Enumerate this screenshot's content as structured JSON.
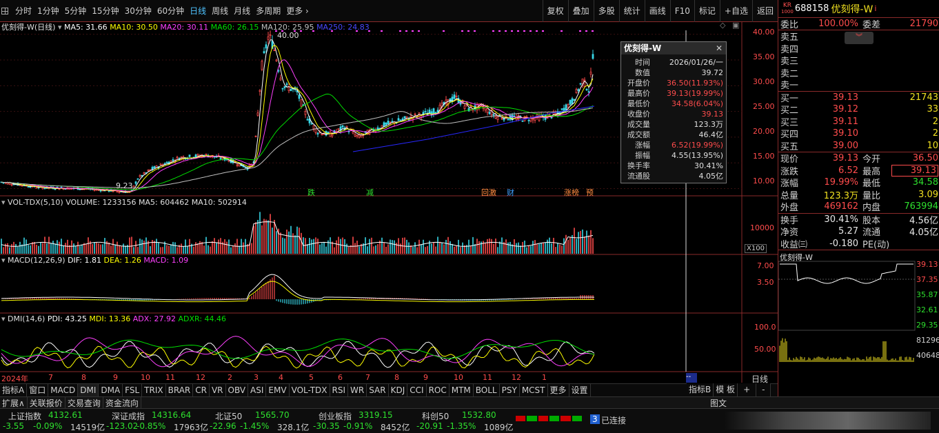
{
  "toolbar": {
    "periods": [
      "分时",
      "1分钟",
      "5分钟",
      "15分钟",
      "30分钟",
      "60分钟",
      "日线",
      "周线",
      "月线",
      "多周期",
      "更多"
    ],
    "active": "日线",
    "right": [
      "复权",
      "叠加",
      "多股",
      "统计",
      "画线",
      "F10",
      "标记",
      "+自选",
      "返回"
    ]
  },
  "main_legend": {
    "title": "优刻得-W(日线)",
    "ma5": "MA5: 31.66",
    "ma10": "MA10: 30.50",
    "ma20": "MA20: 30.11",
    "ma60": "MA60: 26.15",
    "ma120": "MA120: 25.95",
    "ma250": "MA250: 24.83",
    "high_mark": "40.00",
    "low_mark": "9.23"
  },
  "price_axis": [
    "40.00",
    "35.00",
    "30.00",
    "25.00",
    "20.00",
    "15.00",
    "10.00"
  ],
  "event_tags": [
    "跌",
    "减",
    "回激",
    "财",
    "涨榜",
    "预"
  ],
  "vol_legend": {
    "title": "VOL-TDX(5,10)",
    "volume": "VOLUME: 1233156",
    "ma5": "MA5: 604462",
    "ma10": "MA10: 502914",
    "axis": "10000",
    "unit": "X100"
  },
  "macd_legend": {
    "title": "MACD(12,26,9)",
    "dif": "DIF: 1.81",
    "dea": "DEA: 1.26",
    "macd": "MACD: 1.09",
    "axis1": "7.00",
    "axis2": "3.50"
  },
  "dmi_legend": {
    "title": "DMI(14,6)",
    "pdi": "PDI: 43.25",
    "mdi": "MDI: 13.36",
    "adx": "ADX: 27.92",
    "adxr": "ADXR: 44.46",
    "axis1": "100.0",
    "axis2": "50.00"
  },
  "x_axis": [
    "2024年",
    "7",
    "8",
    "9",
    "10",
    "11",
    "12",
    "2",
    "3",
    "4",
    "5",
    "6",
    "7",
    "8",
    "9",
    "10",
    "11",
    "12",
    "1"
  ],
  "tooltip": {
    "title": "优刻得-W",
    "rows": [
      [
        "时间",
        "2026/01/26/一"
      ],
      [
        "数值",
        "39.72"
      ],
      [
        "开盘价",
        "36.50(11.93%)"
      ],
      [
        "最高价",
        "39.13(19.99%)"
      ],
      [
        "最低价",
        "34.58(6.04%)"
      ],
      [
        "收盘价",
        "39.13"
      ],
      [
        "成交量",
        "123.3万"
      ],
      [
        "成交额",
        "46.4亿"
      ],
      [
        "涨幅",
        "6.52(19.99%)"
      ],
      [
        "振幅",
        "4.55(13.95%)"
      ],
      [
        "换手率",
        "30.41%"
      ],
      [
        "流通股",
        "4.05亿"
      ]
    ]
  },
  "quote": {
    "code": "688158",
    "name": "优刻得-W",
    "kr_top": "KR",
    "kr_bot": "1000",
    "weibi_label": "委比",
    "weibi": "100.00%",
    "weicha_label": "委差",
    "weicha": "21790",
    "asks": [
      [
        "卖五",
        "",
        ""
      ],
      [
        "卖四",
        "",
        ""
      ],
      [
        "卖三",
        "",
        ""
      ],
      [
        "卖二",
        "",
        ""
      ],
      [
        "卖一",
        "",
        ""
      ]
    ],
    "bids": [
      [
        "买一",
        "39.13",
        "21743"
      ],
      [
        "买二",
        "39.12",
        "33"
      ],
      [
        "买三",
        "39.11",
        "2"
      ],
      [
        "买四",
        "39.10",
        "2"
      ],
      [
        "买五",
        "39.00",
        "10"
      ]
    ],
    "stats": [
      [
        "现价",
        "39.13",
        "今开",
        "36.50"
      ],
      [
        "涨跌",
        "6.52",
        "最高",
        "39.13"
      ],
      [
        "涨幅",
        "19.99%",
        "最低",
        "34.58"
      ],
      [
        "总量",
        "123.3万",
        "量比",
        "3.09"
      ],
      [
        "外盘",
        "469162",
        "内盘",
        "763994"
      ]
    ],
    "stats2": [
      [
        "换手",
        "30.41%",
        "股本",
        "4.56亿"
      ],
      [
        "净资",
        "5.27",
        "流通",
        "4.05亿"
      ],
      [
        "收益㈢",
        "-0.180",
        "PE(动)",
        ""
      ]
    ]
  },
  "mini": {
    "title": "优刻得-W",
    "prices": [
      "39.13",
      "37.35",
      "35.87",
      "32.61",
      "29.35"
    ],
    "vols": [
      "81296",
      "40648"
    ]
  },
  "bottom_tabs": [
    "指标A",
    "窗口",
    "MACD",
    "DMI",
    "DMA",
    "FSL",
    "TRIX",
    "BRAR",
    "CR",
    "VR",
    "OBV",
    "ASI",
    "EMV",
    "VOL-TDX",
    "RSI",
    "WR",
    "SAR",
    "KDJ",
    "CCI",
    "ROC",
    "MTM",
    "BOLL",
    "PSY",
    "MCST",
    "更多",
    "设置"
  ],
  "bottom_right": [
    "指标B",
    "模 板",
    "+",
    "-"
  ],
  "row2": [
    "扩展∧",
    "关联报价",
    "交易查询",
    "资金流向"
  ],
  "row2_right": [
    "日线",
    "图文"
  ],
  "status": [
    {
      "name": "上证指数",
      "value": "4132.61",
      "chg": "-3.55",
      "pct": "-0.09%",
      "amt": "14519亿"
    },
    {
      "name": "深证成指",
      "value": "14316.64",
      "chg": "-123.02",
      "pct": "-0.85%",
      "amt": "17963亿"
    },
    {
      "name": "北证50",
      "value": "1565.70",
      "chg": "-22.96",
      "pct": "-1.45%",
      "amt": "328.1亿"
    },
    {
      "name": "创业板指",
      "value": "3319.15",
      "chg": "-30.35",
      "pct": "-0.91%",
      "amt": "8452亿"
    },
    {
      "name": "科创50",
      "value": "1532.80",
      "chg": "-20.91",
      "pct": "-1.35%",
      "amt": "1089亿"
    }
  ],
  "connect": {
    "num": "3",
    "label": "已连接"
  },
  "colors": {
    "up": "#ff4c4c",
    "down": "#2ee02e",
    "ma5": "#ffffff",
    "ma10": "#ffff00",
    "ma20": "#ff40ff",
    "ma60": "#00e000",
    "ma120": "#c0c0c0",
    "ma250": "#2828ff",
    "frame": "#8a2a2a"
  }
}
